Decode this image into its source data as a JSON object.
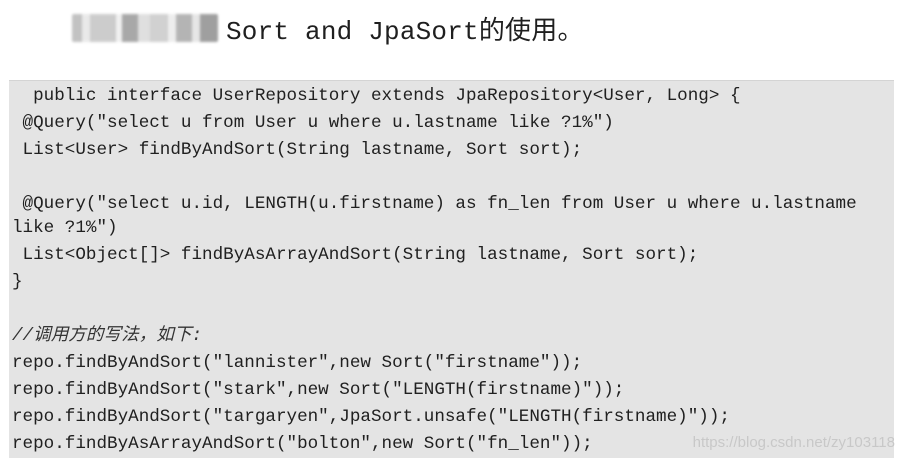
{
  "heading": {
    "text": "Sort and JpaSort的使用。"
  },
  "code": {
    "lines": [
      "  public interface UserRepository extends JpaRepository<User, Long> {",
      " @Query(\"select u from User u where u.lastname like ?1%\")",
      " List<User> findByAndSort(String lastname, Sort sort);",
      "",
      " @Query(\"select u.id, LENGTH(u.firstname) as fn_len from User u where u.lastname",
      "like ?1%\")",
      " List<Object[]> findByAsArrayAndSort(String lastname, Sort sort);",
      "}",
      "",
      "//调用方的写法，如下:",
      "repo.findByAndSort(\"lannister\",new Sort(\"firstname\"));",
      "repo.findByAndSort(\"stark\",new Sort(\"LENGTH(firstname)\"));",
      "repo.findByAndSort(\"targaryen\",JpaSort.unsafe(\"LENGTH(firstname)\"));",
      "repo.findByAsArrayAndSort(\"bolton\",new Sort(\"fn_len\"));"
    ]
  },
  "watermark": {
    "text": "https://blog.csdn.net/zy103118"
  }
}
